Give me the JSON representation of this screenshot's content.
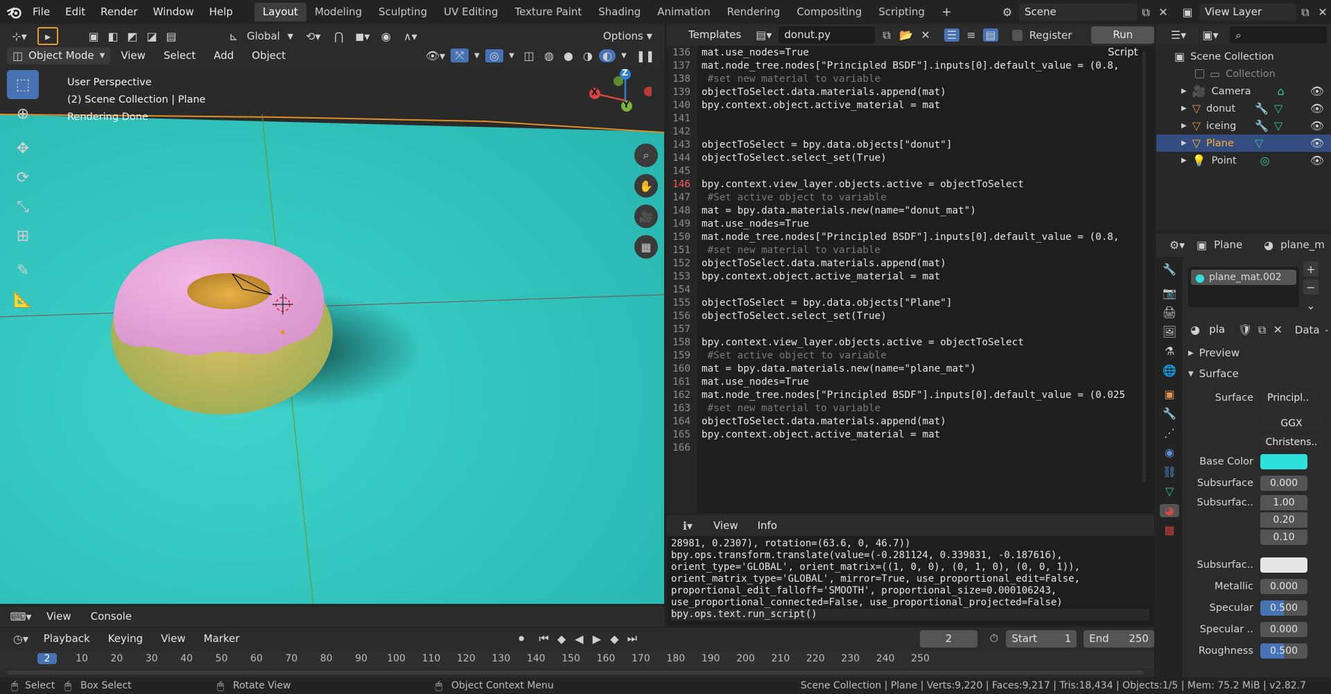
{
  "topbar": {
    "menus": [
      "File",
      "Edit",
      "Render",
      "Window",
      "Help"
    ],
    "workspaces": [
      "Layout",
      "Modeling",
      "Sculpting",
      "UV Editing",
      "Texture Paint",
      "Shading",
      "Animation",
      "Rendering",
      "Compositing",
      "Scripting"
    ],
    "active_workspace": "Layout",
    "add_tab": "+",
    "scene_name": "Scene",
    "view_layer": "View Layer"
  },
  "viewport": {
    "header": {
      "transform_orientation": "Global",
      "options_label": "Options",
      "mode": "Object Mode",
      "menus": [
        "View",
        "Select",
        "Add",
        "Object"
      ]
    },
    "overlay": {
      "line1": "User Perspective",
      "line2": "(2) Scene Collection | Plane",
      "line3": "Rendering Done"
    },
    "gizmo": {
      "x": "X",
      "y": "Y",
      "z": "Z"
    },
    "colors": {
      "floor": "#2dc3bd",
      "donut_icing": "#e8a7d8",
      "donut_dough": "#d3b25a",
      "axis_x": "#d64545",
      "axis_y": "#7bb33a",
      "axis_z": "#2f7fd6"
    }
  },
  "texteditor": {
    "templates_label": "Templates",
    "filename": "donut.py",
    "register_label": "Register",
    "run_script_label": "Run Script",
    "current_line": 146,
    "lines": [
      {
        "n": 136,
        "t": "mat.use_nodes=True"
      },
      {
        "n": 137,
        "t": "mat.node_tree.nodes[\"Principled BSDF\"].inputs[0].default_value = (0.8,"
      },
      {
        "n": 138,
        "t": " #set new material to variable"
      },
      {
        "n": 139,
        "t": "objectToSelect.data.materials.append(mat)"
      },
      {
        "n": 140,
        "t": "bpy.context.object.active_material = mat"
      },
      {
        "n": 141,
        "t": ""
      },
      {
        "n": 142,
        "t": ""
      },
      {
        "n": 143,
        "t": "objectToSelect = bpy.data.objects[\"donut\"]"
      },
      {
        "n": 144,
        "t": "objectToSelect.select_set(True)"
      },
      {
        "n": 145,
        "t": ""
      },
      {
        "n": 146,
        "t": "bpy.context.view_layer.objects.active = objectToSelect"
      },
      {
        "n": 147,
        "t": " #Set active object to variable"
      },
      {
        "n": 148,
        "t": "mat = bpy.data.materials.new(name=\"donut_mat\")"
      },
      {
        "n": 149,
        "t": "mat.use_nodes=True"
      },
      {
        "n": 150,
        "t": "mat.node_tree.nodes[\"Principled BSDF\"].inputs[0].default_value = (0.8,"
      },
      {
        "n": 151,
        "t": " #set new material to variable"
      },
      {
        "n": 152,
        "t": "objectToSelect.data.materials.append(mat)"
      },
      {
        "n": 153,
        "t": "bpy.context.object.active_material = mat"
      },
      {
        "n": 154,
        "t": ""
      },
      {
        "n": 155,
        "t": "objectToSelect = bpy.data.objects[\"Plane\"]"
      },
      {
        "n": 156,
        "t": "objectToSelect.select_set(True)"
      },
      {
        "n": 157,
        "t": ""
      },
      {
        "n": 158,
        "t": "bpy.context.view_layer.objects.active = objectToSelect"
      },
      {
        "n": 159,
        "t": " #Set active object to variable"
      },
      {
        "n": 160,
        "t": "mat = bpy.data.materials.new(name=\"plane_mat\")"
      },
      {
        "n": 161,
        "t": "mat.use_nodes=True"
      },
      {
        "n": 162,
        "t": "mat.node_tree.nodes[\"Principled BSDF\"].inputs[0].default_value = (0.025"
      },
      {
        "n": 163,
        "t": " #set new material to variable"
      },
      {
        "n": 164,
        "t": "objectToSelect.data.materials.append(mat)"
      },
      {
        "n": 165,
        "t": "bpy.context.object.active_material = mat"
      },
      {
        "n": 166,
        "t": ""
      }
    ]
  },
  "info": {
    "menus": [
      "View",
      "Info"
    ],
    "lines": [
      "28981, 0.2307), rotation=(63.6, 0, 46.7))",
      "bpy.ops.transform.translate(value=(-0.281124, 0.339831, -0.187616), orient_type='GLOBAL', orient_matrix=((1, 0, 0), (0, 1, 0), (0, 0, 1)), orient_matrix_type='GLOBAL', mirror=True, use_proportional_edit=False, proportional_edit_falloff='SMOOTH', proportional_size=0.000106243, use_proportional_connected=False, use_proportional_projected=False)",
      "bpy.ops.text.run_script()"
    ]
  },
  "console_header": {
    "menus": [
      "View",
      "Console"
    ]
  },
  "outliner": {
    "root": "Scene Collection",
    "collection": "Collection",
    "items": [
      {
        "name": "Camera",
        "color": "#e0904a"
      },
      {
        "name": "donut",
        "color": "#e0904a"
      },
      {
        "name": "iceing",
        "color": "#e0904a"
      },
      {
        "name": "Plane",
        "color": "#e0904a",
        "selected": true
      },
      {
        "name": "Point",
        "color": "#e0904a"
      }
    ]
  },
  "properties": {
    "object_name": "Plane",
    "material_short": "plane_m",
    "material_slot": "plane_mat.002",
    "datablock_short": "pla",
    "data_label": "Data",
    "preview_label": "Preview",
    "surface_panel": "Surface",
    "surface_label": "Surface",
    "surface_value": "Principl..",
    "distribution": "GGX",
    "subsurface_method": "Christens..",
    "base_color_label": "Base Color",
    "base_color": "#2ee0dc",
    "subsurface_label": "Subsurface",
    "subsurface_value": "0.000",
    "subsurface_radius_label": "Subsurfac..",
    "subsurface_radius": [
      "1.00",
      "0.20",
      "0.10"
    ],
    "subsurface_color_label": "Subsurfac..",
    "subsurface_color": "#e6e6e6",
    "metallic_label": "Metallic",
    "metallic_value": "0.000",
    "specular_label": "Specular",
    "specular_value": "0.500",
    "specular_tint_label": "Specular ..",
    "specular_tint_value": "0.000",
    "roughness_label": "Roughness",
    "roughness_value": "0.500"
  },
  "timeline": {
    "menus": [
      "Playback",
      "Keying",
      "View",
      "Marker"
    ],
    "current_frame": "2",
    "start_label": "Start",
    "start": "1",
    "end_label": "End",
    "end": "250",
    "ruler": [
      "2",
      "10",
      "20",
      "30",
      "40",
      "50",
      "60",
      "70",
      "80",
      "90",
      "100",
      "110",
      "120",
      "130",
      "140",
      "150",
      "160",
      "170",
      "180",
      "190",
      "200",
      "210",
      "220",
      "230",
      "240",
      "250"
    ]
  },
  "statusbar": {
    "select": "Select",
    "box_select": "Box Select",
    "rotate_view": "Rotate View",
    "context_menu": "Object Context Menu",
    "stats": "Scene Collection | Plane | Verts:9,220 | Faces:9,217 | Tris:18,434 | Objects:1/5 | Mem: 75.2 MiB | v2.82.7"
  }
}
